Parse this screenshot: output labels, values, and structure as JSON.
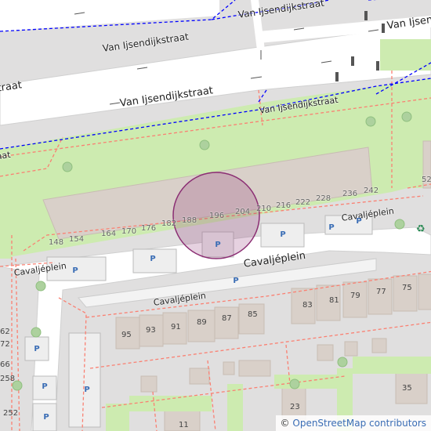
{
  "streets": {
    "van_ijsendijkstraat": "Van Ijsendijkstraat",
    "cavaljeplein": "Cavaljéplein"
  },
  "house_numbers": [
    "148",
    "154",
    "164",
    "170",
    "176",
    "182",
    "188",
    "196",
    "204",
    "210",
    "216",
    "222",
    "228",
    "236",
    "242",
    "52"
  ],
  "building_numbers": [
    "83",
    "81",
    "79",
    "77",
    "75",
    "95",
    "93",
    "91",
    "89",
    "87",
    "85",
    "23",
    "35",
    "11",
    "62",
    "72",
    "66",
    "258",
    "252"
  ],
  "parking_symbol": "P",
  "recycling_icon": "recycling-icon",
  "attribution": {
    "symbol": "©",
    "text": "OpenStreetMap contributors"
  },
  "colors": {
    "road": "#ffffff",
    "grass": "#cdebb0",
    "building": "#d9d0c9",
    "parking": "#eeeeee",
    "cycleway": "#0000ff",
    "footway": "#fa8072",
    "selection": "#8b2e73",
    "parking_text": "#3a6db5"
  }
}
